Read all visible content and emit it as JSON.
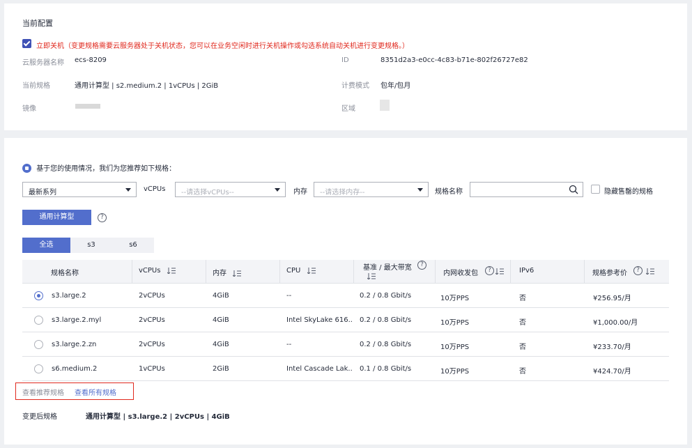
{
  "current_config": {
    "title": "当前配置",
    "shutdown_label": "立即关机",
    "shutdown_note": "（变更规格需要云服务器处于关机状态，您可以在业务空闲时进行关机操作或勾选系统自动关机进行变更规格。）",
    "server_name_label": "云服务器名称",
    "server_name_value": "ecs-8209",
    "id_label": "ID",
    "id_value": "8351d2a3-e0cc-4c83-b71e-802f26727e82",
    "spec_label": "当前规格",
    "spec_value": "通用计算型 | s2.medium.2 | 1vCPUs | 2GiB",
    "billing_label": "计费模式",
    "billing_value": "包年/包月",
    "image_label": "镜像",
    "region_label": "区域"
  },
  "recommend": {
    "hint": "基于您的使用情况，我们为您推荐如下规格：",
    "series_select": "最新系列",
    "vcpus_label": "vCPUs",
    "vcpus_placeholder": "--请选择vCPUs--",
    "memory_label": "内存",
    "memory_placeholder": "--请选择内存--",
    "spec_name_label": "规格名称",
    "hide_soldout_label": "隐藏售罄的规格",
    "type_button": "通用计算型",
    "tabs": [
      "全选",
      "s3",
      "s6"
    ]
  },
  "table": {
    "headers": {
      "name": "规格名称",
      "vcpus": "vCPUs",
      "memory": "内存",
      "cpu": "CPU",
      "bandwidth_line1": "基准 / 最大带宽",
      "pps": "内网收发包",
      "ipv6": "IPv6",
      "price": "规格参考价"
    },
    "rows": [
      {
        "name": "s3.large.2",
        "vcpus": "2vCPUs",
        "memory": "4GiB",
        "cpu": "--",
        "bandwidth": "0.2 / 0.8 Gbit/s",
        "pps": "10万PPS",
        "ipv6": "否",
        "price": "¥256.95/月"
      },
      {
        "name": "s3.large.2.myl",
        "vcpus": "2vCPUs",
        "memory": "4GiB",
        "cpu": "Intel SkyLake 616...",
        "bandwidth": "0.2 / 0.8 Gbit/s",
        "pps": "10万PPS",
        "ipv6": "否",
        "price": "¥1,000.00/月"
      },
      {
        "name": "s3.large.2.zn",
        "vcpus": "2vCPUs",
        "memory": "4GiB",
        "cpu": "--",
        "bandwidth": "0.2 / 0.8 Gbit/s",
        "pps": "10万PPS",
        "ipv6": "否",
        "price": "¥233.70/月"
      },
      {
        "name": "s6.medium.2",
        "vcpus": "1vCPUs",
        "memory": "2GiB",
        "cpu": "Intel Cascade Lak...",
        "bandwidth": "0.1 / 0.8 Gbit/s",
        "pps": "10万PPS",
        "ipv6": "否",
        "price": "¥424.70/月"
      }
    ]
  },
  "links": {
    "recommended": "查看推荐规格",
    "all": "查看所有规格"
  },
  "after_change": {
    "label": "变更后规格",
    "value": "通用计算型 | s3.large.2 | 2vCPUs | 4GiB"
  },
  "colors": {
    "primary": "#526ecc",
    "warning": "#e0281d",
    "checkbox": "#3f51b5"
  }
}
